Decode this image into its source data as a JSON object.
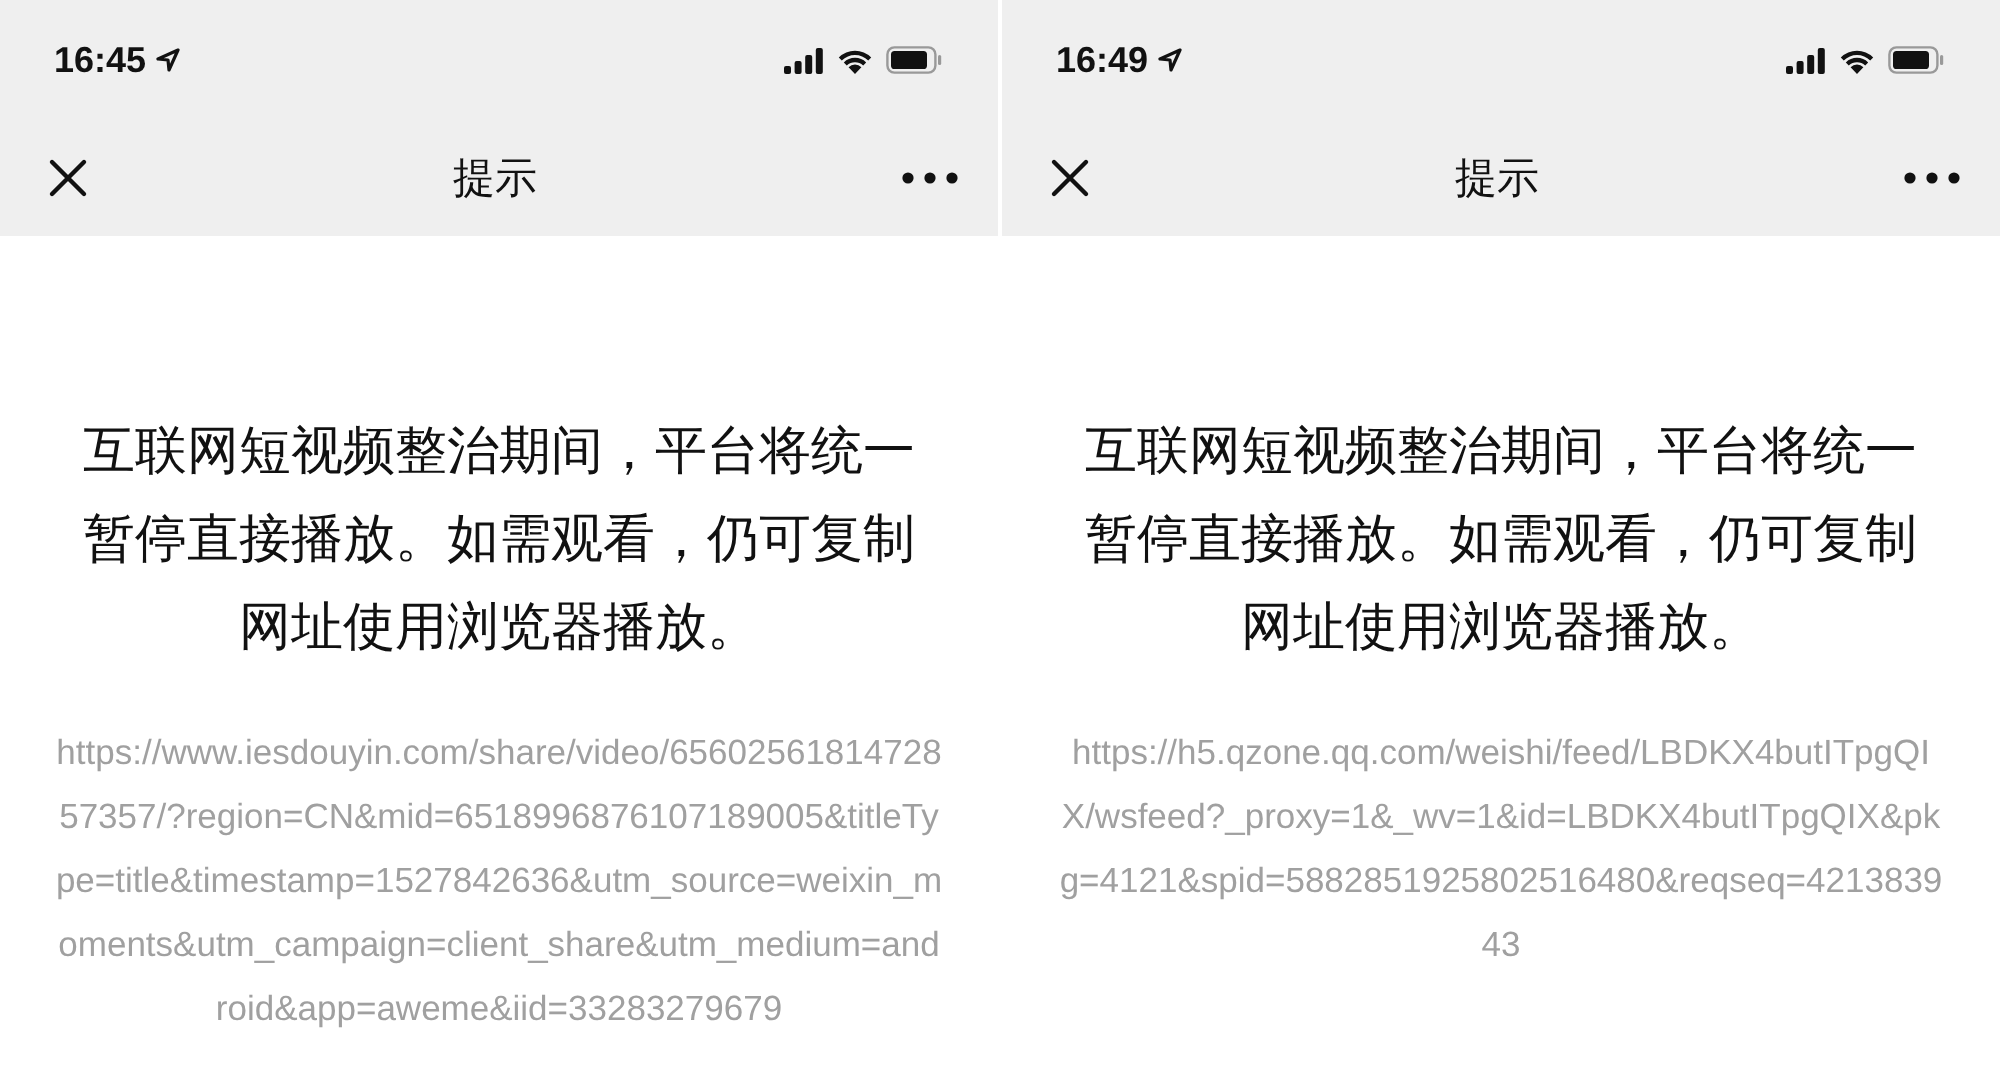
{
  "screens": [
    {
      "status_bar": {
        "time": "16:45"
      },
      "nav": {
        "title": "提示"
      },
      "message": "互联网短视频整治期间，平台将统一暂停直接播放。如需观看，仍可复制网址使用浏览器播放。",
      "url": "https://www.iesdouyin.com/share/video/6560256181472857357/?region=CN&mid=6518996876107189005&titleType=title&timestamp=1527842636&utm_source=weixin_moments&utm_campaign=client_share&utm_medium=android&app=aweme&iid=33283279679"
    },
    {
      "status_bar": {
        "time": "16:49"
      },
      "nav": {
        "title": "提示"
      },
      "message": "互联网短视频整治期间，平台将统一暂停直接播放。如需观看，仍可复制网址使用浏览器播放。",
      "url": "https://h5.qzone.qq.com/weishi/feed/LBDKX4butITpgQIX/wsfeed?_proxy=1&_wv=1&id=LBDKX4butITpgQIX&pkg=4121&spid=5882851925802516480&reqseq=421383943"
    }
  ]
}
